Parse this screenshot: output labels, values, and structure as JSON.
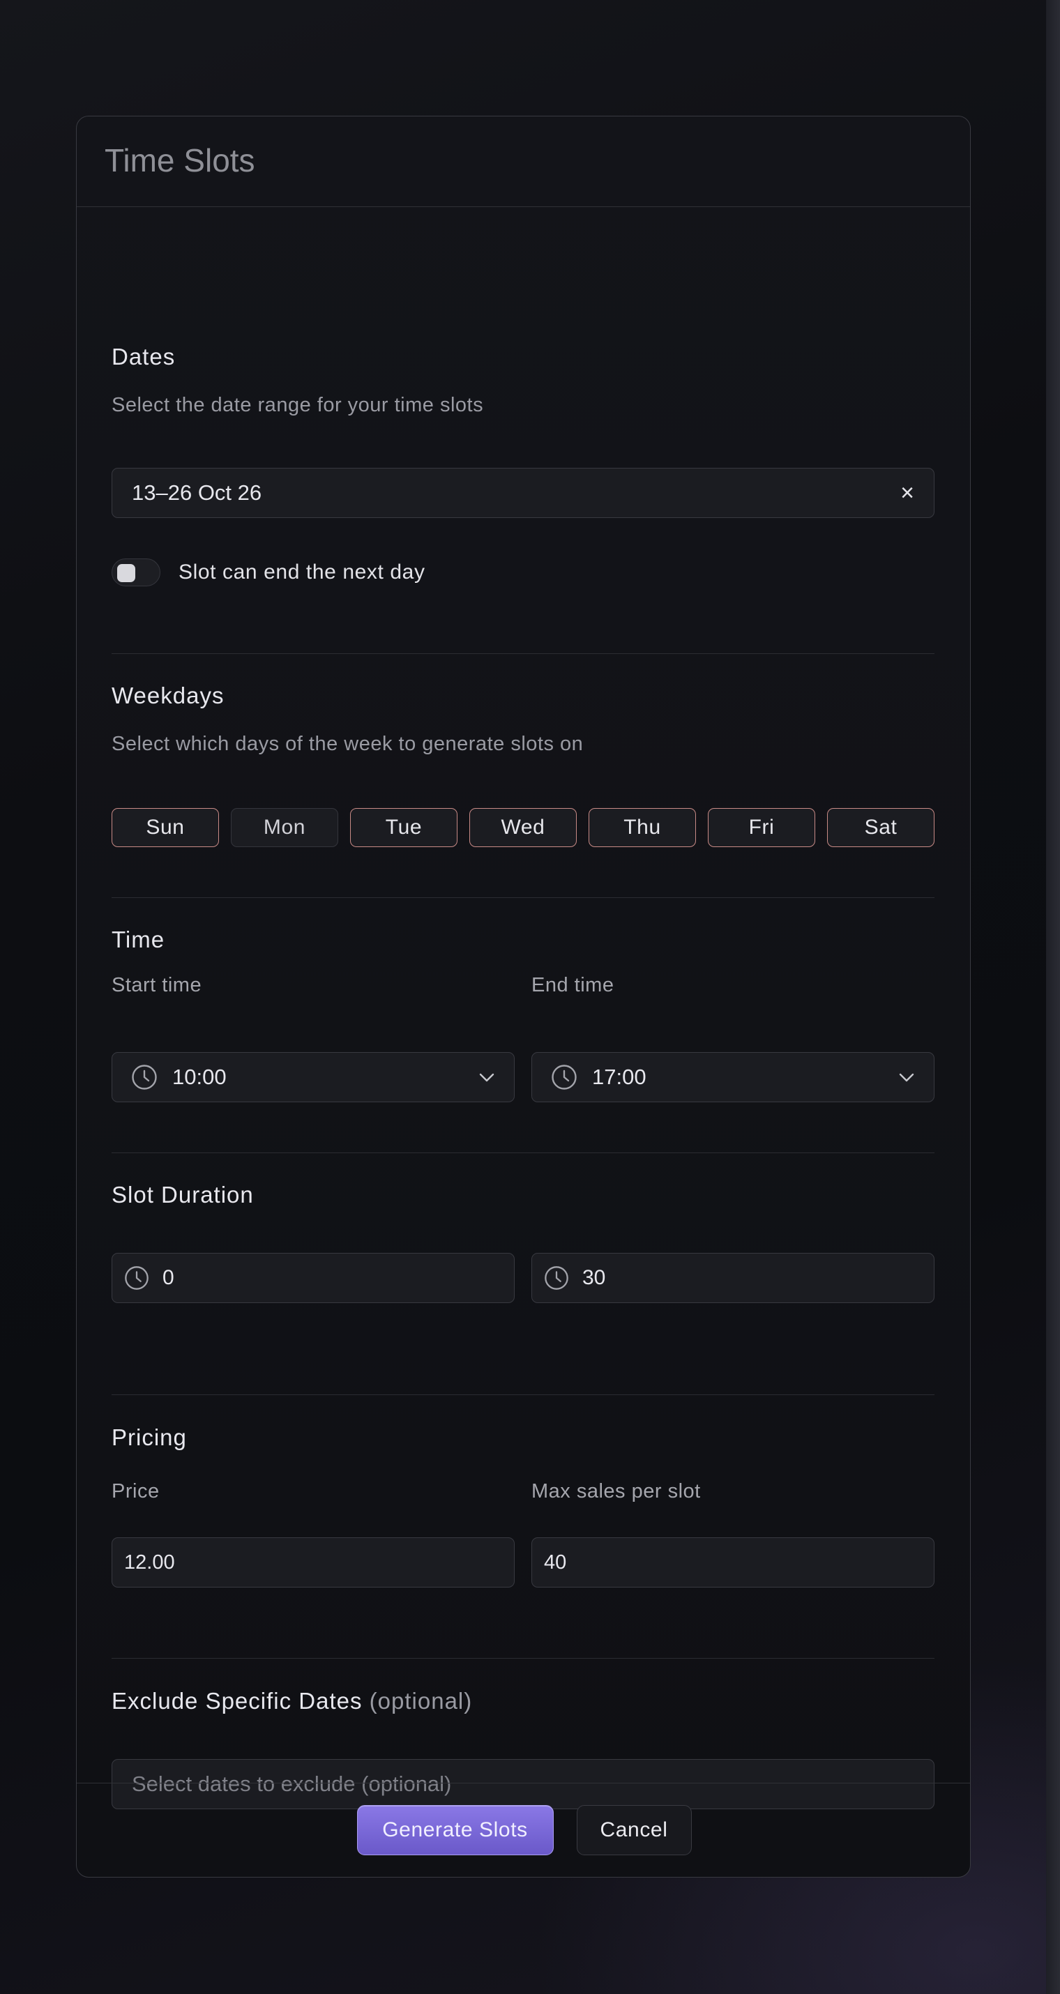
{
  "modal": {
    "title": "Time Slots"
  },
  "dates": {
    "title": "Dates",
    "subtitle": "Select the date range for your time slots",
    "range_value": "13–26 Oct 26",
    "clear_glyph": "×",
    "next_day_toggle": {
      "label": "Slot can end the next day",
      "on": false
    }
  },
  "weekdays": {
    "title": "Weekdays",
    "subtitle": "Select which days of the week to generate slots on",
    "days": [
      {
        "label": "Sun",
        "selected": true
      },
      {
        "label": "Mon",
        "selected": false
      },
      {
        "label": "Tue",
        "selected": true
      },
      {
        "label": "Wed",
        "selected": true
      },
      {
        "label": "Thu",
        "selected": true
      },
      {
        "label": "Fri",
        "selected": true
      },
      {
        "label": "Sat",
        "selected": true
      }
    ]
  },
  "time": {
    "title": "Time",
    "start_label": "Start time",
    "start_value": "10:00",
    "end_label": "End time",
    "end_value": "17:00"
  },
  "slot_duration": {
    "title": "Slot Duration",
    "hours_value": "0",
    "minutes_value": "30"
  },
  "pricing": {
    "title": "Pricing",
    "price_label": "Price",
    "price_value": "12.00",
    "max_sales_label": "Max sales per slot",
    "max_sales_value": "40"
  },
  "exclude": {
    "title": "Exclude Specific Dates",
    "optional_suffix": "(optional)",
    "placeholder": "Select dates to exclude (optional)"
  },
  "footer": {
    "generate_label": "Generate Slots",
    "cancel_label": "Cancel"
  },
  "colors": {
    "accent": "#7a68d8",
    "selected_day_border": "#c88a86"
  },
  "icons": [
    "close-icon",
    "clock-icon",
    "chevron-down-icon"
  ]
}
